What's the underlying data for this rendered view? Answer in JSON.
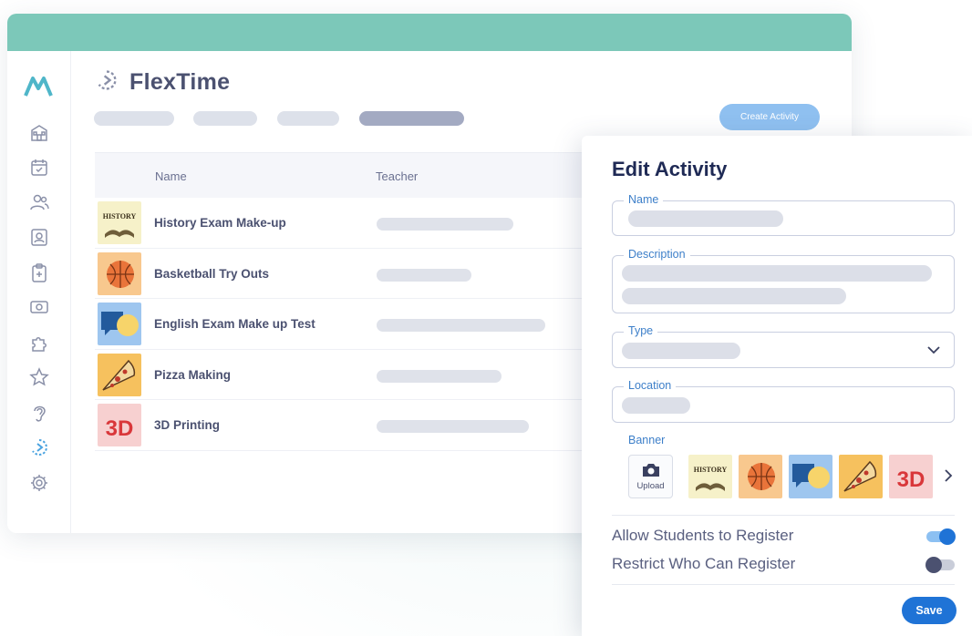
{
  "app": {
    "title": "FlexTime",
    "create_label": "Create Activity"
  },
  "table": {
    "headers": {
      "name": "Name",
      "teacher": "Teacher"
    },
    "rows": [
      {
        "name": "History Exam Make-up",
        "thumb": "history-icon",
        "thumb_text": "HISTORY"
      },
      {
        "name": "Basketball Try Outs",
        "thumb": "basketball-icon"
      },
      {
        "name": "English Exam Make up Test",
        "thumb": "speech-bubbles-icon"
      },
      {
        "name": "Pizza Making",
        "thumb": "pizza-icon"
      },
      {
        "name": "3D Printing",
        "thumb": "3d-printing-icon",
        "thumb_text": "3D"
      }
    ]
  },
  "sidebar": {
    "icons": [
      "school-icon",
      "calendar-check-icon",
      "users-icon",
      "id-card-icon",
      "clipboard-icon",
      "ticket-icon",
      "puzzle-icon",
      "star-icon",
      "ear-icon",
      "flextime-icon",
      "settings-icon"
    ]
  },
  "edit_panel": {
    "title": "Edit Activity",
    "fields": {
      "name": "Name",
      "description": "Description",
      "type": "Type",
      "location": "Location"
    },
    "banner_label": "Banner",
    "upload_label": "Upload",
    "banner_thumb_texts": {
      "history": "HISTORY",
      "printing": "3D"
    },
    "toggles": [
      {
        "label": "Allow Students to Register",
        "on": true
      },
      {
        "label": "Restrict Who Can Register",
        "on": false
      }
    ],
    "save_label": "Save"
  },
  "colors": {
    "topbar": "#7cc8b9",
    "accent": "#1f73d6",
    "create_button": "#8fc0f0",
    "field_label": "#3d7fc9",
    "toggle_on": "#1f73d6"
  }
}
